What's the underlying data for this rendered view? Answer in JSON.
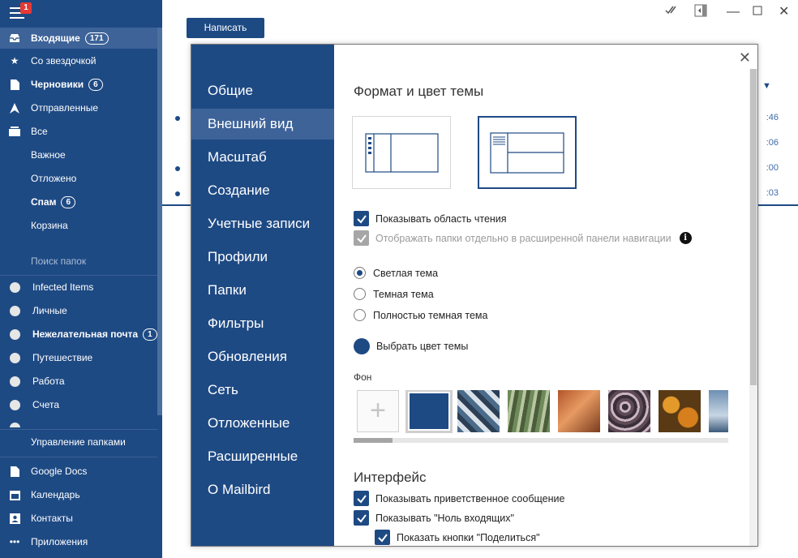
{
  "nav": {
    "notification_count": "1",
    "items": [
      {
        "label": "Входящие",
        "count": "171",
        "icon": "inbox-icon",
        "bold": true
      },
      {
        "label": "Со звездочкой",
        "icon": "star-icon"
      },
      {
        "label": "Черновики",
        "count": "6",
        "icon": "draft-icon",
        "bold": true
      },
      {
        "label": "Отправленные",
        "icon": "sent-icon"
      },
      {
        "label": "Все",
        "icon": "all-mail-icon"
      }
    ],
    "subitems": [
      {
        "label": "Важное"
      },
      {
        "label": "Отложено"
      },
      {
        "label": "Спам",
        "count": "6",
        "bold": true
      },
      {
        "label": "Корзина"
      }
    ],
    "folder_search_label": "Поиск папок",
    "folders": [
      {
        "label": "Infected Items"
      },
      {
        "label": "Личные"
      },
      {
        "label": "Нежелательная почта",
        "count": "1",
        "bold": true
      },
      {
        "label": "Путешествие"
      },
      {
        "label": "Работа"
      },
      {
        "label": "Счета"
      }
    ],
    "manage_folders": "Управление папками",
    "apps": [
      {
        "label": "Google Docs",
        "icon": "document-icon"
      },
      {
        "label": "Календарь",
        "icon": "calendar-icon"
      },
      {
        "label": "Контакты",
        "icon": "contacts-icon"
      },
      {
        "label": "Приложения",
        "icon": "apps-icon"
      }
    ]
  },
  "main": {
    "compose_label": "Написать",
    "window_controls": [
      "mark-read-icon",
      "collapse-panel-icon",
      "minimize-icon",
      "maximize-icon",
      "close-icon"
    ],
    "message_times": [
      ":46",
      ":06",
      ":00",
      ":03"
    ]
  },
  "dialog": {
    "sidebar": [
      {
        "label": "Общие"
      },
      {
        "label": "Внешний вид",
        "active": true
      },
      {
        "label": "Масштаб"
      },
      {
        "label": "Создание"
      },
      {
        "label": "Учетные записи"
      },
      {
        "label": "Профили"
      },
      {
        "label": "Папки"
      },
      {
        "label": "Фильтры"
      },
      {
        "label": "Обновления"
      },
      {
        "label": "Сеть"
      },
      {
        "label": "Отложенные"
      },
      {
        "label": "Расширенные"
      },
      {
        "label": "О Mailbird"
      }
    ],
    "theme_section_title": "Формат и цвет темы",
    "layouts": [
      {
        "name": "layout-three-column",
        "selected": false
      },
      {
        "name": "layout-split-horizontal",
        "selected": true
      }
    ],
    "show_reading_pane": "Показывать область чтения",
    "show_folders_separately": "Отображать папки отдельно в расширенной панели навигации",
    "themes": [
      {
        "label": "Светлая тема",
        "selected": true
      },
      {
        "label": "Темная тема",
        "selected": false
      },
      {
        "label": "Полностью темная тема",
        "selected": false
      }
    ],
    "choose_theme_color": "Выбрать цвет темы",
    "theme_color": "#1e4a84",
    "background_label": "Фон",
    "interface_title": "Интерфейс",
    "show_welcome": "Показывать приветственное сообщение",
    "show_inbox_zero": "Показывать \"Ноль входящих\"",
    "show_share_buttons": "Показать кнопки \"Поделиться\""
  }
}
